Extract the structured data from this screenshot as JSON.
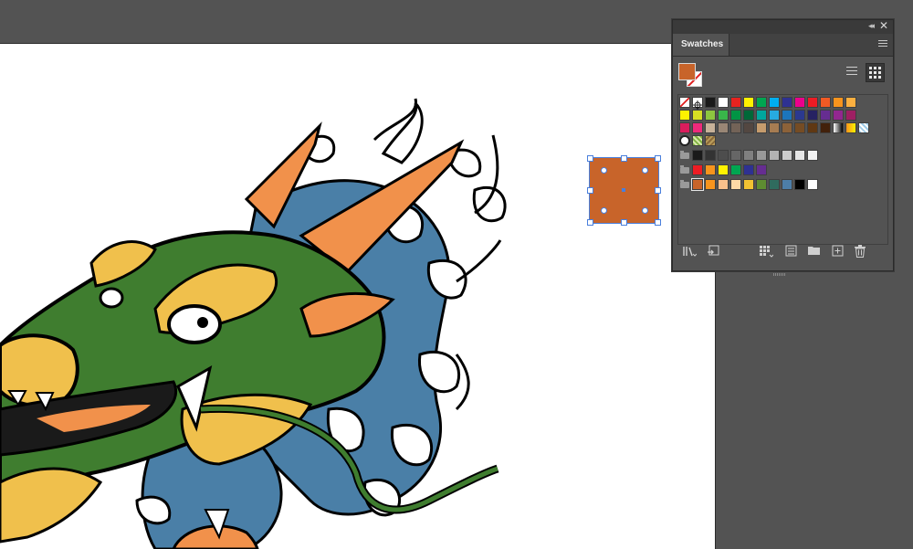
{
  "panel": {
    "title": "Swatches",
    "collapse_icon": "double-chevron-left-icon",
    "close_icon": "close-icon",
    "menu_icon": "hamburger-menu-icon",
    "fill_color": "#c8642a",
    "stroke": "none",
    "view_modes": [
      "list-view",
      "grid-view"
    ],
    "active_view": "grid-view",
    "bottom_icons": [
      "swatch-libraries-menu-icon",
      "place-swatch-icon",
      "swatch-kind-icon",
      "swatch-options-icon",
      "new-color-group-icon",
      "new-swatch-icon",
      "delete-swatch-icon"
    ]
  },
  "swatches": {
    "row1": [
      "none",
      "registration",
      "#1a1a1a",
      "#ffffff",
      "#e6231f",
      "#fff200",
      "#00a651",
      "#00aeef",
      "#2e3192",
      "#ec008c",
      "#ed1c24",
      "#f15a24",
      "#f7941d",
      "#fbb040"
    ],
    "row2": [
      "#fff200",
      "#d7df23",
      "#8dc63f",
      "#39b54a",
      "#009444",
      "#006838",
      "#00a79d",
      "#27aae1",
      "#1c75bc",
      "#2b3990",
      "#262262",
      "#662d91",
      "#92278f",
      "#9e1f63"
    ],
    "row3": [
      "#da1c5c",
      "#ee2a7b",
      "#c7b299",
      "#998675",
      "#736357",
      "#534741",
      "#c69c6d",
      "#a67c52",
      "#8c6239",
      "#754c24",
      "#603813",
      "#42210b",
      "gradient-white-black",
      "gradient-orange-yellow",
      "pattern-blue"
    ],
    "row4": [
      "pattern-circle",
      "pattern-green-texture",
      "pattern-leaves"
    ],
    "group_grays": [
      "#1a1a1a",
      "#333333",
      "#4d4d4d",
      "#666666",
      "#808080",
      "#999999",
      "#b3b3b3",
      "#cccccc",
      "#e6e6e6",
      "#f2f2f2"
    ],
    "group_brights": [
      "#ed1c24",
      "#f7941d",
      "#fff200",
      "#00a651",
      "#2e3192",
      "#662d91"
    ],
    "group_document": [
      "#c8642a",
      "#f7941d",
      "#f9c08b",
      "#fcd9a6",
      "#f1c232",
      "#5e8c31",
      "#2f6b5e",
      "#4d7ea8",
      "#000000",
      "#ffffff"
    ]
  },
  "selection": {
    "fill": "#c8642a",
    "bounding_color": "#4a7fdc"
  },
  "artwork": {
    "subject": "dragon-illustration",
    "colors": {
      "outline": "#000000",
      "green": "#3f7d2f",
      "yellow": "#f0c04c",
      "orange": "#f1914b",
      "blue": "#4a7fa7",
      "white": "#ffffff"
    }
  },
  "canvas": {
    "pasteboard": "#535353",
    "artboard": "#ffffff"
  }
}
